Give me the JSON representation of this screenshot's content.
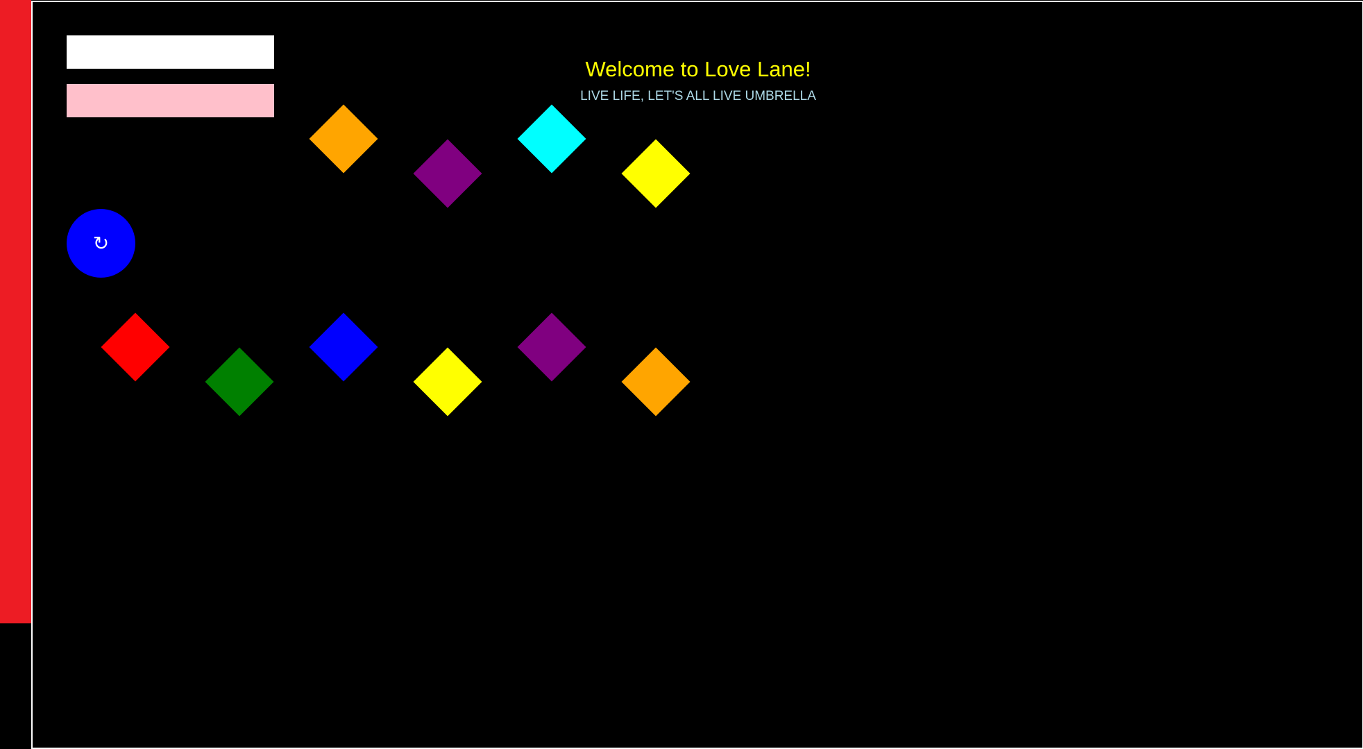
{
  "header": {
    "title": "Welcome to Love Lane!",
    "subtitle": "LIVE LIFE, LET'S ALL LIVE UMBRELLA",
    "title_color": "#ffff00",
    "subtitle_color": "#add8e6"
  },
  "colors": {
    "background": "#000000",
    "left_bar": "#ed1c24",
    "frame_border": "#ffffff",
    "white_bar": "#ffffff",
    "pink_bar": "#ffc0cb",
    "refresh_button": "#0000ff"
  },
  "refresh_button": {
    "icon": "refresh-icon",
    "glyph": "↻"
  },
  "diamonds": {
    "top_row": [
      {
        "color": "#ffa500"
      },
      {
        "color": "#800080"
      },
      {
        "color": "#00ffff"
      },
      {
        "color": "#ffff00"
      }
    ],
    "bottom_row": [
      {
        "color": "#ff0000"
      },
      {
        "color": "#008000"
      },
      {
        "color": "#0000ff"
      },
      {
        "color": "#ffff00"
      },
      {
        "color": "#800080"
      },
      {
        "color": "#ffa500"
      }
    ]
  }
}
